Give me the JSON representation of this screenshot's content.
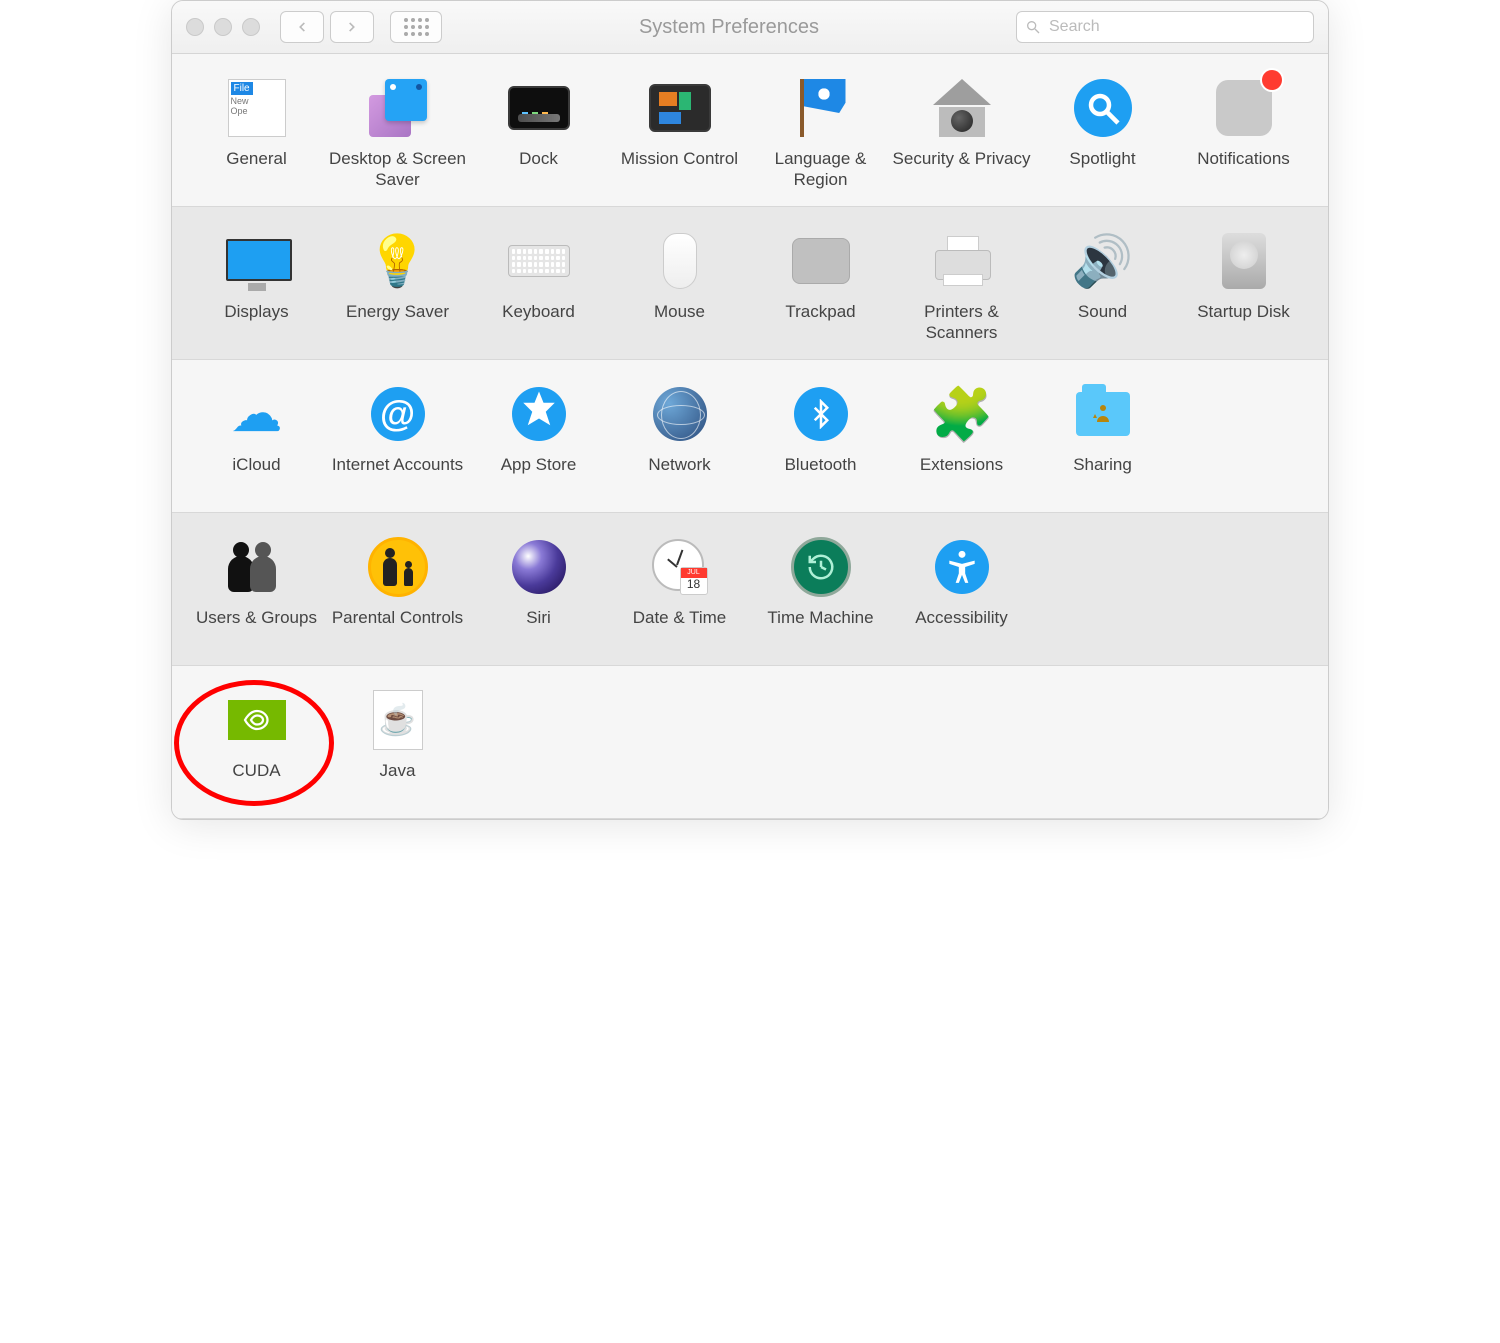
{
  "window": {
    "title": "System Preferences"
  },
  "search": {
    "placeholder": "Search"
  },
  "rows": [
    {
      "style": "light",
      "items": [
        {
          "key": "general",
          "label": "General"
        },
        {
          "key": "desktop",
          "label": "Desktop & Screen Saver"
        },
        {
          "key": "dock",
          "label": "Dock"
        },
        {
          "key": "mission",
          "label": "Mission Control"
        },
        {
          "key": "language",
          "label": "Language & Region"
        },
        {
          "key": "security",
          "label": "Security & Privacy"
        },
        {
          "key": "spotlight",
          "label": "Spotlight"
        },
        {
          "key": "notifications",
          "label": "Notifications",
          "badge": true
        }
      ]
    },
    {
      "style": "alt",
      "items": [
        {
          "key": "displays",
          "label": "Displays"
        },
        {
          "key": "energy",
          "label": "Energy Saver"
        },
        {
          "key": "keyboard",
          "label": "Keyboard"
        },
        {
          "key": "mouse",
          "label": "Mouse"
        },
        {
          "key": "trackpad",
          "label": "Trackpad"
        },
        {
          "key": "printers",
          "label": "Printers & Scanners"
        },
        {
          "key": "sound",
          "label": "Sound"
        },
        {
          "key": "startup",
          "label": "Startup Disk"
        }
      ]
    },
    {
      "style": "light",
      "items": [
        {
          "key": "icloud",
          "label": "iCloud"
        },
        {
          "key": "internet",
          "label": "Internet Accounts"
        },
        {
          "key": "appstore",
          "label": "App Store"
        },
        {
          "key": "network",
          "label": "Network"
        },
        {
          "key": "bluetooth",
          "label": "Bluetooth"
        },
        {
          "key": "extensions",
          "label": "Extensions"
        },
        {
          "key": "sharing",
          "label": "Sharing"
        }
      ]
    },
    {
      "style": "alt",
      "items": [
        {
          "key": "users",
          "label": "Users & Groups"
        },
        {
          "key": "parental",
          "label": "Parental Controls"
        },
        {
          "key": "siri",
          "label": "Siri"
        },
        {
          "key": "datetime",
          "label": "Date & Time"
        },
        {
          "key": "timemachine",
          "label": "Time Machine"
        },
        {
          "key": "accessibility",
          "label": "Accessibility"
        }
      ]
    },
    {
      "style": "light",
      "items": [
        {
          "key": "cuda",
          "label": "CUDA",
          "annotated": true
        },
        {
          "key": "java",
          "label": "Java"
        }
      ]
    }
  ],
  "calendar": {
    "month": "JUL",
    "day": "18"
  }
}
